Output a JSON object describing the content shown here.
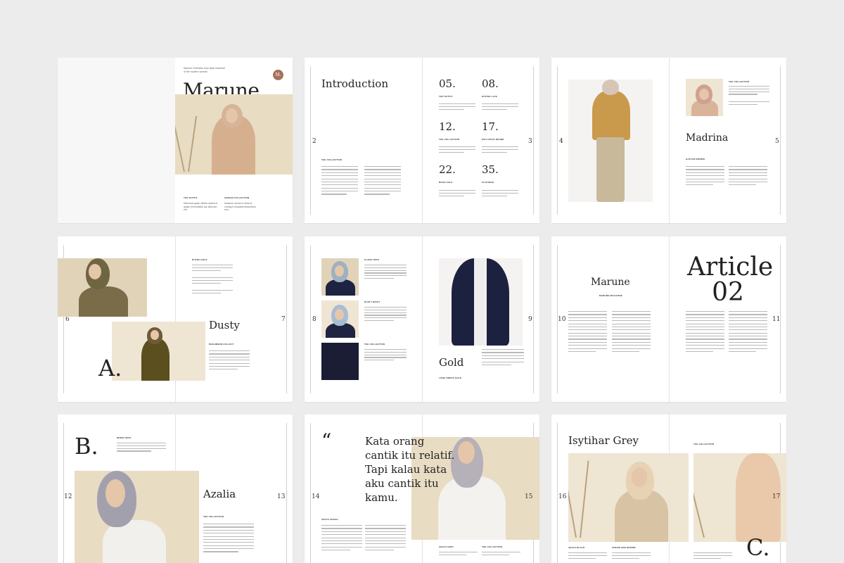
{
  "colors": {
    "background": "#ececec",
    "accent": "#a4725a",
    "beige": "#e8dcc3"
  },
  "spread1": {
    "intro_line1": "Marune Collection new hijab essential",
    "intro_line2": "of the modern woman",
    "logo": "M.",
    "title": "Marune.",
    "label_left": "TOP OUTFIT",
    "label_right": "ARDANI COLLECTION",
    "text_left": "Nesciunt quam officiis autem in ipsam exercitation qui laborum est.",
    "text_right": "Nostrum omnis in dicta id cumque voluptas temporibus rem."
  },
  "spread2": {
    "title": "Introduction",
    "page_left": "2",
    "page_right": "3",
    "collection_label": "THE COLLECTION",
    "stats": [
      {
        "number": "05.",
        "label": "TOP OUTFIT"
      },
      {
        "number": "08.",
        "label": "RATING LATE"
      },
      {
        "number": "12.",
        "label": "THE COLLECTION"
      },
      {
        "number": "17.",
        "label": "EXCLUSIVE BRAND"
      },
      {
        "number": "22.",
        "label": "ROAD SALE"
      },
      {
        "number": "35.",
        "label": "CLOTHING"
      }
    ]
  },
  "spread3": {
    "title": "Madrina",
    "page_left": "4",
    "page_right": "5",
    "label_top": "THE COLLECTION",
    "label_mid": "KAFTAN BROWN"
  },
  "spread4": {
    "title": "Dusty",
    "letter": "A.",
    "page_left": "6",
    "page_right": "7",
    "label_top": "DUTEE GOLD",
    "label_mid": "MAGHRIBIN COLLECT"
  },
  "spread5": {
    "title": "Gold",
    "page_left": "8",
    "page_right": "9",
    "labels": [
      "FLARE TOPS",
      "DUSTY BRAIT",
      "THE COLLECTION"
    ],
    "label_bottom": "LONG DRESS GOLD"
  },
  "spread6": {
    "title": "Marune",
    "subtitle": "MARUNE MAGAZINE",
    "article_line1": "Article",
    "article_line2": "02",
    "page_left": "10",
    "page_right": "11"
  },
  "spread7": {
    "title": "Azalia",
    "letter": "B.",
    "page_left": "12",
    "page_right": "13",
    "label_top": "BREEZ MAXI",
    "label_mid": "THE COLLECTION"
  },
  "spread8": {
    "quote_mark": "“",
    "quote_lines": [
      "Kata orang",
      "cantik itu relatif.",
      "Tapi kalau kata",
      "aku cantik itu",
      "kamu."
    ],
    "page_left": "14",
    "page_right": "15",
    "label_left": "ABAYA CERAH",
    "label_mid": "ABAYA GREY",
    "label_right": "THE COLLECTION"
  },
  "spread9": {
    "title": "Isytihar Grey",
    "letter": "C.",
    "page_left": "16",
    "page_right": "17",
    "label_top": "THE COLLECTION",
    "label_left": "ABAYA BLACK",
    "label_right": "CREAM AND BROWN"
  }
}
